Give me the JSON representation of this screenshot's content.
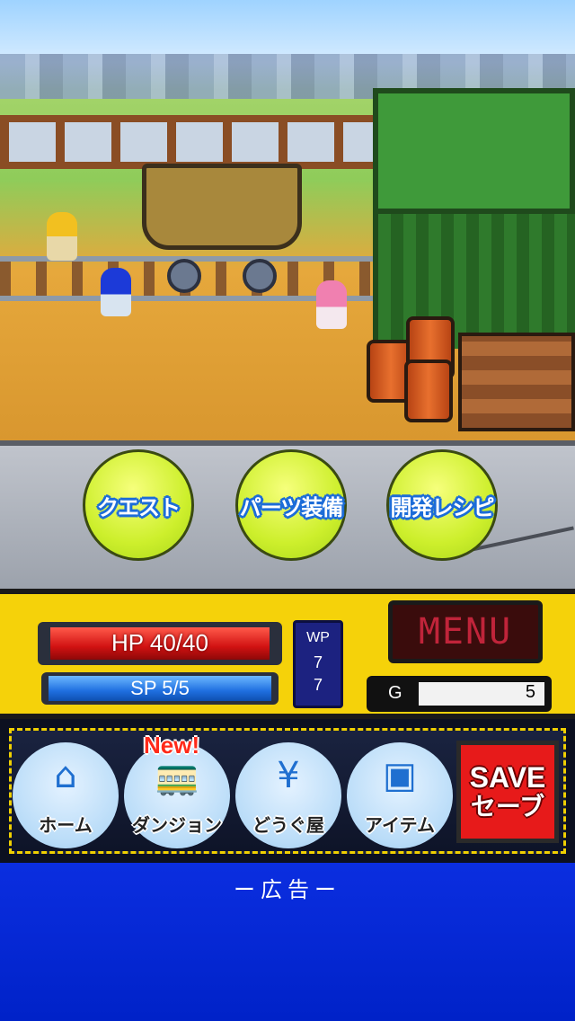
{
  "actions": {
    "quest": "クエスト",
    "parts_equip": "パーツ装備",
    "dev_recipe": "開発レシピ"
  },
  "status": {
    "hp": "HP 40/40",
    "sp": "SP 5/5",
    "hp_fraction": 1.0,
    "sp_fraction": 1.0,
    "wp_label": "WP",
    "wp_current": "7",
    "wp_max": "7",
    "gold_label": "G",
    "gold_value": "5"
  },
  "menu_label": "MENU",
  "nav": {
    "items": [
      {
        "label": "ホーム",
        "icon": "home-icon"
      },
      {
        "label": "ダンジョン",
        "icon": "train-icon"
      },
      {
        "label": "どうぐ屋",
        "icon": "yen-icon"
      },
      {
        "label": "アイテム",
        "icon": "bag-icon"
      }
    ],
    "new_badge": "New!",
    "save_en": "SAVE",
    "save_jp": "セーブ"
  },
  "ad_label": "ー広告ー",
  "colors": {
    "accent_yellow": "#f5d20a",
    "action_button": "#cdef2c",
    "hp_red": "#d11212",
    "sp_blue": "#1f6fe0",
    "save_red": "#e71a1a"
  }
}
